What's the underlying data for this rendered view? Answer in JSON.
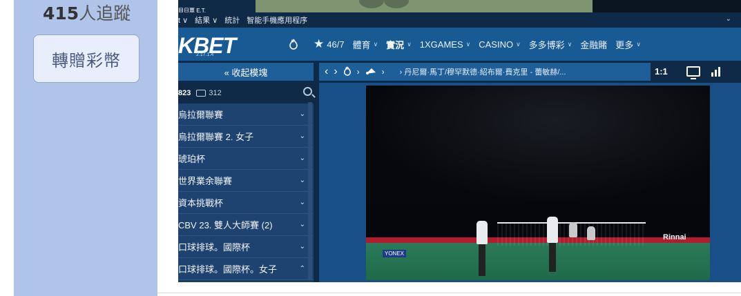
{
  "profile": {
    "followers_count": "415",
    "followers_label": "人追蹤",
    "gift_button": "轉贈彩幣"
  },
  "top_menu": {
    "items": [
      "t ∨",
      "結果 ∨",
      "統計",
      "智能手機應用程序"
    ],
    "overlay_text": "目日覃 E.T."
  },
  "brand": {
    "logo": "KBET",
    "version": "2.17.1.4"
  },
  "navbar": {
    "live_count": "46/7",
    "items": [
      {
        "label": "體育",
        "bold": false,
        "dropdown": true
      },
      {
        "label": "實況",
        "bold": true,
        "dropdown": true
      },
      {
        "label": "1XGAMES",
        "bold": false,
        "dropdown": true
      },
      {
        "label": "CASINO",
        "bold": false,
        "dropdown": true
      },
      {
        "label": "多多博彩",
        "bold": false,
        "dropdown": true
      },
      {
        "label": "金融賭",
        "bold": false,
        "dropdown": false
      },
      {
        "label": "更多",
        "bold": false,
        "dropdown": true
      }
    ]
  },
  "subbar": {
    "collapse_label": "« 收起模塊",
    "breadcrumb_route": "› 丹尼爾·馬丁/穆罕默德·紹布爾·費克里 - 蕾敏赫/...",
    "ratio": "1:1"
  },
  "sidebar": {
    "count": "823",
    "messages": "312",
    "leagues": [
      {
        "label": "烏拉爾聯賽",
        "chevron": "⌄"
      },
      {
        "label": "烏拉爾聯賽 2. 女子",
        "chevron": "⌄"
      },
      {
        "label": "琥珀杯",
        "chevron": "⌄"
      },
      {
        "label": "世界業余聯賽",
        "chevron": "⌄"
      },
      {
        "label": "資本挑戰杯",
        "chevron": "⌄"
      },
      {
        "label": "CBV 23. 雙人大師賽 (2)",
        "chevron": "⌄"
      },
      {
        "label": "口球排球。國際杯",
        "chevron": "⌄"
      },
      {
        "label": "口球排球。國際杯。女子",
        "chevron": "⌃"
      }
    ]
  },
  "video": {
    "sponsor_1": "Rinnai",
    "sponsor_2": "YONEX"
  },
  "colors": {
    "left_panel": "#b0c4ea",
    "navbar": "#185a93",
    "dark_navy": "#0e2a46"
  }
}
